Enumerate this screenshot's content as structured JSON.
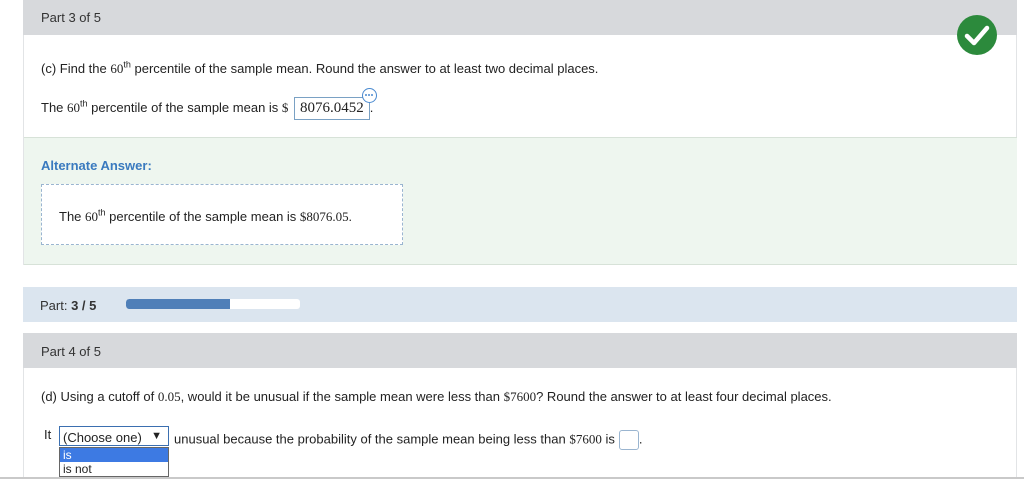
{
  "part3": {
    "header": "Part 3 of 5",
    "question": {
      "pre": "(c) Find the ",
      "num": "60",
      "sup": "th",
      "post": " percentile of the sample mean. Round the answer to at least two decimal places."
    },
    "answer_line": {
      "pre": "The ",
      "num": "60",
      "sup": "th",
      "post": " percentile of the sample mean is ",
      "currency": "$",
      "value": "8076.0452",
      "end": "."
    },
    "status_icon": "check-circle-icon",
    "alternate": {
      "title": "Alternate Answer:",
      "pre": "The ",
      "num": "60",
      "sup": "th",
      "post": " percentile of the sample mean is ",
      "value": "$8076.05."
    }
  },
  "progress": {
    "label": "Part: ",
    "value_text": "3 / 5",
    "fraction": 0.6
  },
  "part4": {
    "header": "Part 4 of 5",
    "question": {
      "pre": "(d) Using a cutoff of ",
      "cutoff": "0.05",
      "mid": ", would it be unusual if the sample mean were less than ",
      "amount": "$7600",
      "post": "? Round the answer to at least four decimal places."
    },
    "answer": {
      "lead": "It",
      "select_value": "(Choose one)",
      "select_arrow": "▼",
      "options": [
        "is",
        "is not"
      ],
      "rest_pre": "unusual because the probability of the sample mean being less than ",
      "rest_amount": "$7600",
      "rest_post": " is",
      "end": "."
    }
  },
  "colors": {
    "header_bg": "#d7d9dc",
    "alt_bg": "#eef6ef",
    "check_green": "#2c8a3c",
    "progress_fill": "#4f7fb8",
    "link_blue": "#3a7abf"
  }
}
